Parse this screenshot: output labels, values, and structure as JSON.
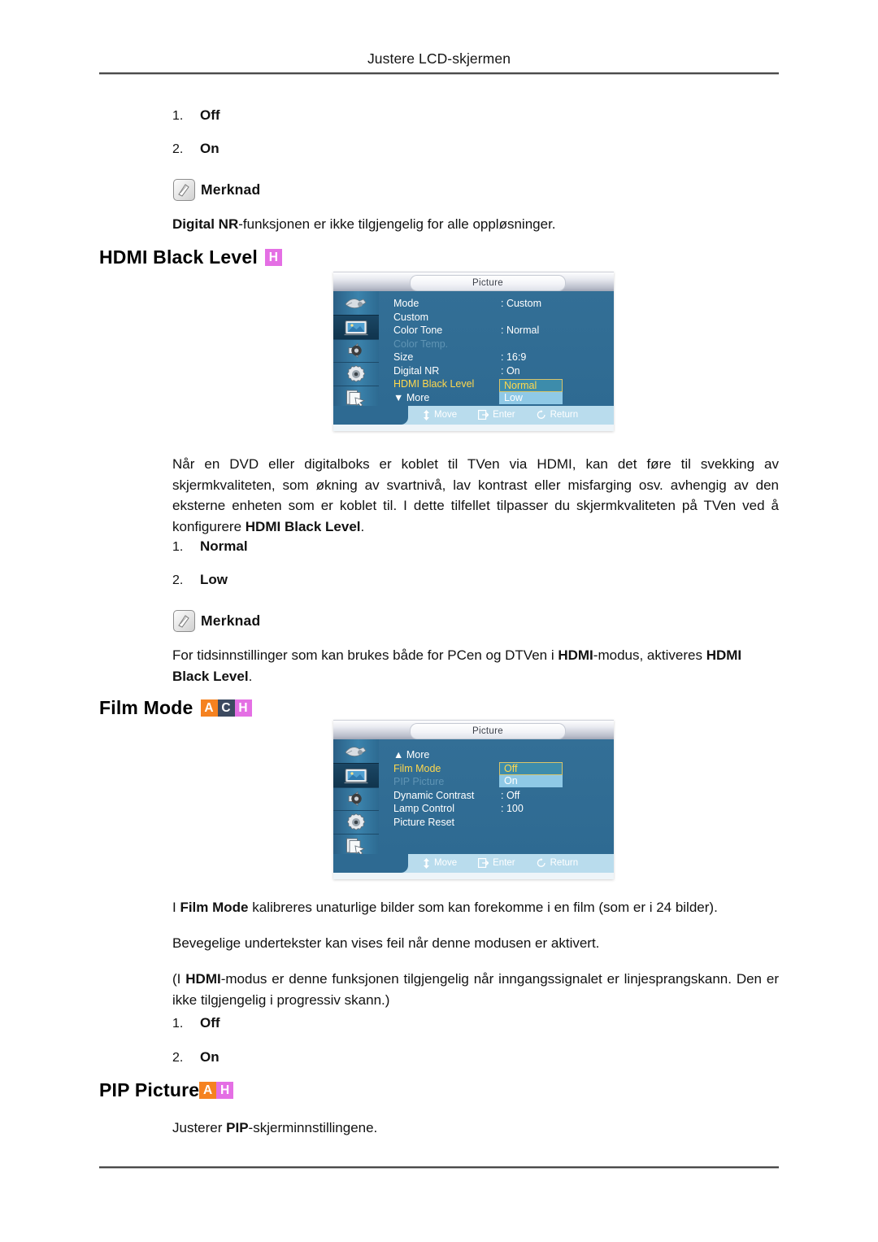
{
  "header": {
    "title": "Justere LCD-skjermen"
  },
  "digital_nr": {
    "options": [
      {
        "num": "1.",
        "label": "Off"
      },
      {
        "num": "2.",
        "label": "On"
      }
    ],
    "note_label": "Merknad",
    "note_icon": "pencil-note-icon",
    "note_text_prefix": "Digital NR",
    "note_text_rest": "-funksjonen er ikke tilgjengelig for alle oppløsninger."
  },
  "hdmi_black_level": {
    "heading": "HDMI Black Level",
    "badges": [
      {
        "letter": "H",
        "color": "#e46fe4"
      }
    ],
    "paragraph_part1": "Når en DVD eller digitalboks er koblet til TVen via HDMI, kan det føre til svekking av skjermkvaliteten, som økning av svartnivå, lav kontrast eller misfarging osv. avhengig av den eksterne enheten som er koblet til. I dette tilfellet tilpasser du skjermkvaliteten på TVen ved å konfigurere ",
    "paragraph_bold": "HDMI Black Level",
    "paragraph_part2": ".",
    "options": [
      {
        "num": "1.",
        "label": "Normal"
      },
      {
        "num": "2.",
        "label": "Low"
      }
    ],
    "note_label": "Merknad",
    "note_icon": "pencil-note-icon",
    "note_part1": "For tidsinnstillinger som kan brukes både for PCen og DTVen i ",
    "note_bold1": "HDMI",
    "note_part2": "-modus, aktiveres ",
    "note_bold2": "HDMI Black Level",
    "note_part3": "."
  },
  "osd_hdmi": {
    "title": "Picture",
    "sidebar_icons": [
      "input-plug-icon",
      "picture-monitor-icon",
      "sound-speaker-icon",
      "setup-gear-icon",
      "multi-control-icon"
    ],
    "selected_sidebar_index": 1,
    "rows": [
      {
        "label": "Mode",
        "value": ": Custom",
        "state": "normal"
      },
      {
        "label": "Custom",
        "value": "",
        "state": "normal"
      },
      {
        "label": "Color Tone",
        "value": ": Normal",
        "state": "normal"
      },
      {
        "label": "Color Temp.",
        "value": "",
        "state": "dim"
      },
      {
        "label": "Size",
        "value": ": 16:9",
        "state": "normal"
      },
      {
        "label": "Digital NR",
        "value": ": On",
        "state": "normal"
      },
      {
        "label": "HDMI Black Level",
        "value": ":",
        "state": "active"
      },
      {
        "label": "▼ More",
        "value": "",
        "state": "normal"
      }
    ],
    "popup": {
      "selected": "Normal",
      "unselected": "Low"
    },
    "hints": [
      {
        "icon": "move-updown-icon",
        "label": "Move"
      },
      {
        "icon": "enter-icon",
        "label": "Enter"
      },
      {
        "icon": "return-icon",
        "label": "Return"
      }
    ]
  },
  "film_mode": {
    "heading": "Film Mode",
    "badges": [
      {
        "letter": "A",
        "color": "#f58220"
      },
      {
        "letter": "C",
        "color": "#3c4a60"
      },
      {
        "letter": "H",
        "color": "#e46fe4"
      }
    ],
    "p1_part1": "I ",
    "p1_bold": "Film Mode",
    "p1_part2": " kalibreres unaturlige bilder som kan forekomme i en film (som er i 24 bilder).",
    "p2": "Bevegelige undertekster kan vises feil når denne modusen er aktivert.",
    "p3_part1": "(I ",
    "p3_bold": "HDMI",
    "p3_part2": "-modus er denne funksjonen tilgjengelig når inngangssignalet er linjesprangskann. Den er ikke tilgjengelig i progressiv skann.)",
    "options": [
      {
        "num": "1.",
        "label": "Off"
      },
      {
        "num": "2.",
        "label": "On"
      }
    ]
  },
  "osd_film": {
    "title": "Picture",
    "sidebar_icons": [
      "input-plug-icon",
      "picture-monitor-icon",
      "sound-speaker-icon",
      "setup-gear-icon",
      "multi-control-icon"
    ],
    "selected_sidebar_index": 1,
    "rows": [
      {
        "label": "▲  More",
        "value": "",
        "state": "normal"
      },
      {
        "label": "Film Mode",
        "value": ":",
        "state": "active"
      },
      {
        "label": "PIP Picture",
        "value": "",
        "state": "dim"
      },
      {
        "label": "Dynamic Contrast",
        "value": ": Off",
        "state": "normal"
      },
      {
        "label": "Lamp Control",
        "value": ": 100",
        "state": "normal"
      },
      {
        "label": "Picture Reset",
        "value": "",
        "state": "normal"
      }
    ],
    "popup": {
      "selected": "Off",
      "unselected": "On"
    },
    "hints": [
      {
        "icon": "move-updown-icon",
        "label": "Move"
      },
      {
        "icon": "enter-icon",
        "label": "Enter"
      },
      {
        "icon": "return-icon",
        "label": "Return"
      }
    ]
  },
  "pip_picture": {
    "heading": "PIP Picture",
    "badges": [
      {
        "letter": "A",
        "color": "#f58220"
      },
      {
        "letter": "H",
        "color": "#e46fe4"
      }
    ],
    "text_part1": "Justerer ",
    "text_bold": "PIP",
    "text_part2": "-skjerminnstillingene."
  }
}
